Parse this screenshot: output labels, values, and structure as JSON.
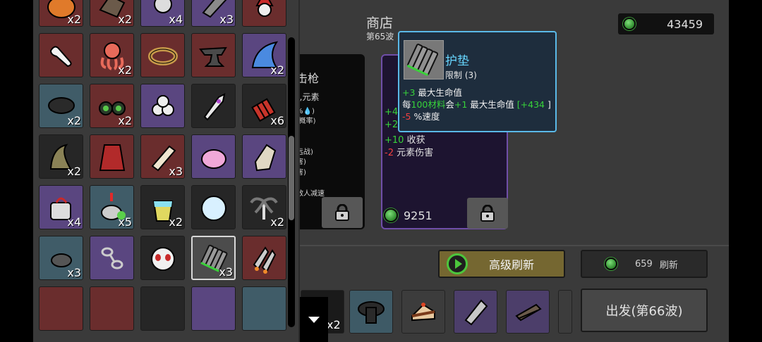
{
  "shop": {
    "title": "商店",
    "wave": "第65波",
    "currency": "43459"
  },
  "card1": {
    "title": "击枪",
    "line1": "),元素",
    "line2": "%💧)",
    "line3": "-概率)",
    "line4": "远战)",
    "line5": "害)",
    "line6": "害)",
    "line7": "敌人减速"
  },
  "card2": {
    "stat1_val": "+4",
    "stat2_val": "+2",
    "stat3_val": "+10",
    "stat3_name": "收获",
    "stat4_val": "-2",
    "stat4_name": "元素伤害",
    "price": "9251"
  },
  "tooltip": {
    "name": "护垫",
    "limit": "限制 (3)",
    "l1_val": "+3",
    "l1_text": " 最大生命值",
    "l2_a": "每",
    "l2_b": "100材料",
    "l2_c": "会",
    "l2_d": "+1",
    "l2_e": " 最大生命值 ",
    "l2_f": "[+434",
    "l2_g": " ]",
    "l3_val": "-5",
    "l3_text": " %速度"
  },
  "buttons": {
    "refresh_premium": "高级刷新",
    "refresh_cost": "659",
    "refresh": "刷新",
    "go": "出发(第66波)"
  },
  "owned": {
    "first_count": "x2"
  },
  "inventory": {
    "counts": [
      "x2",
      "x2",
      "x4",
      "x3",
      "",
      "",
      "x2",
      "",
      "",
      "x2",
      "x2",
      "x2",
      "",
      "",
      "x6",
      "x2",
      "",
      "x3",
      "",
      "",
      "x4",
      "x5",
      "x2",
      "",
      "x2",
      "x3",
      "",
      "",
      "x3",
      ""
    ]
  },
  "colors": {
    "accent_tooltip": "#5ab9e8",
    "positive": "#37d23a",
    "negative": "#f24040",
    "premium_button": "#756731"
  }
}
